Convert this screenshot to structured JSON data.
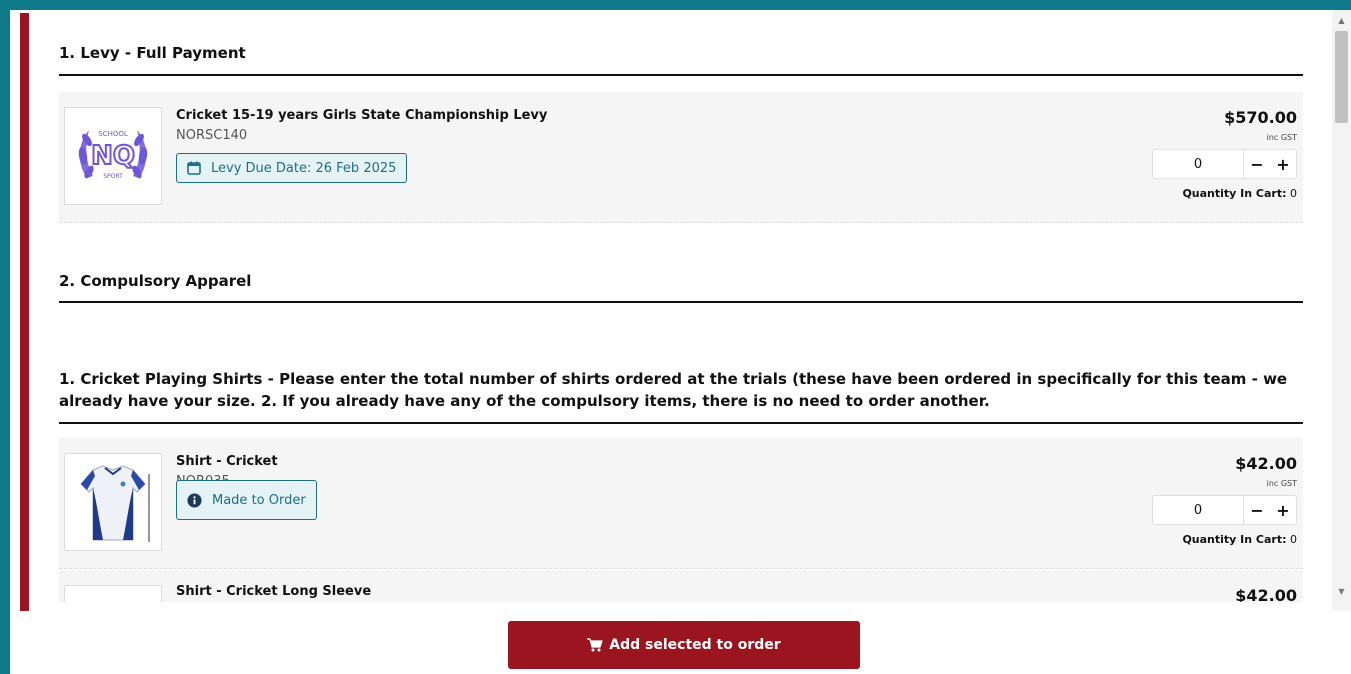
{
  "sections": [
    {
      "heading": "1. Levy - Full Payment"
    },
    {
      "heading": "2. Compulsory Apparel"
    }
  ],
  "apparel_note": "1. Cricket Playing Shirts - Please enter the total number of shirts ordered at the trials (these have been ordered in specifically for this team - we already have your size. 2. If you already have any of the compulsory items, there is no need to order another.",
  "products": [
    {
      "name": "Cricket 15-19 years Girls State Championship Levy",
      "code": "NORSC140",
      "badge": "Levy Due Date: 26 Feb 2025",
      "badge_icon": "calendar-icon",
      "price": "$570.00",
      "gst": "inc GST",
      "qty": "0",
      "in_cart_label": "Quantity In Cart:",
      "in_cart_value": "0",
      "logo_text": [
        "SCHOOL",
        "NQ",
        "SPORT"
      ]
    },
    {
      "name": "Shirt - Cricket",
      "code": "NOR035",
      "badge": "Made to Order",
      "badge_icon": "info-icon",
      "price": "$42.00",
      "gst": "inc GST",
      "qty": "0",
      "in_cart_label": "Quantity In Cart:",
      "in_cart_value": "0"
    },
    {
      "name": "Shirt - Cricket Long Sleeve",
      "price": "$42.00"
    }
  ],
  "qty_minus": "−",
  "qty_plus": "+",
  "add_button": {
    "label": "Add selected to order",
    "icon": "cart-icon"
  },
  "colors": {
    "accent": "#9b1520",
    "frame": "#0e7a8a",
    "badge": "#1e6f86"
  }
}
